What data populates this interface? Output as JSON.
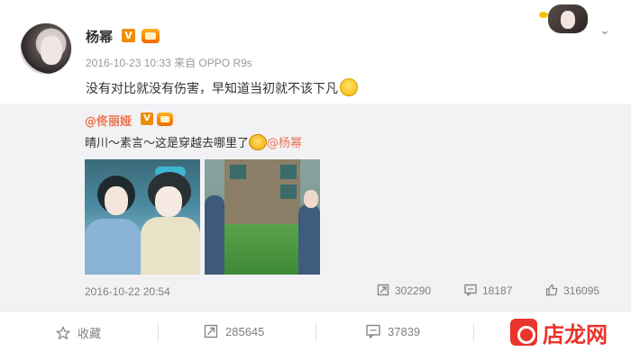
{
  "post": {
    "username": "杨幂",
    "verified_mark": "V",
    "timestamp": "2016-10-23 10:33",
    "source": "来自 OPPO R9s",
    "text": "没有对比就没有伤害，早知道当初就不该下凡"
  },
  "retweet": {
    "user": "@佟丽娅",
    "verified_mark": "V",
    "text": "晴川～素言～这是穿越去哪里了",
    "mention": "@杨幂",
    "date": "2016-10-22 20:54",
    "repost_count": "302290",
    "comment_count": "18187",
    "like_count": "316095"
  },
  "footer": {
    "favorite_label": "收藏",
    "repost_count": "285645",
    "comment_count": "37839"
  },
  "watermark": {
    "text": "店龙网"
  },
  "icons": {
    "repost": "repost-icon",
    "comment": "comment-icon",
    "like": "thumbs-up-icon",
    "favorite": "star-icon",
    "menu": "chevron-down-icon"
  },
  "colors": {
    "mention": "#eb7350",
    "vip_badge": "#f08c00",
    "watermark": "#e8342b"
  }
}
